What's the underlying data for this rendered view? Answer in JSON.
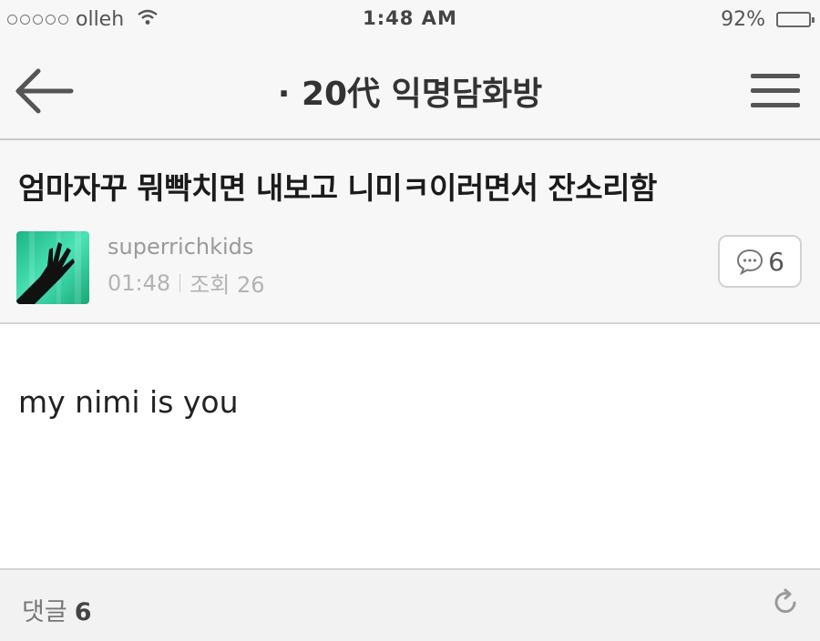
{
  "status_bar": {
    "carrier": "olleh",
    "time": "1:48 AM",
    "battery": "92%",
    "signal_icon": "signal-dots-icon",
    "wifi_icon": "wifi-icon",
    "moon_icon": "moon-icon",
    "battery_icon": "battery-icon"
  },
  "nav": {
    "title": "· 20代 익명담화방",
    "back_icon": "back-arrow-icon",
    "menu_icon": "hamburger-menu-icon"
  },
  "post": {
    "title": "엄마자꾸 뭐빡치면 내보고 니미ㅋ이러면서 잔소리함",
    "author": "superrichkids",
    "time": "01:48",
    "views": "조회 26",
    "comment_count": "6",
    "body": "my nimi is you"
  },
  "comments_bar": {
    "label": "댓글",
    "count": "6",
    "refresh_icon": "refresh-icon"
  },
  "colors": {
    "bar_background": "#f7f7f7",
    "avatar_green": "#2ed3a0",
    "text_dark": "#1b1b1b",
    "text_muted": "#9a9a9a"
  }
}
